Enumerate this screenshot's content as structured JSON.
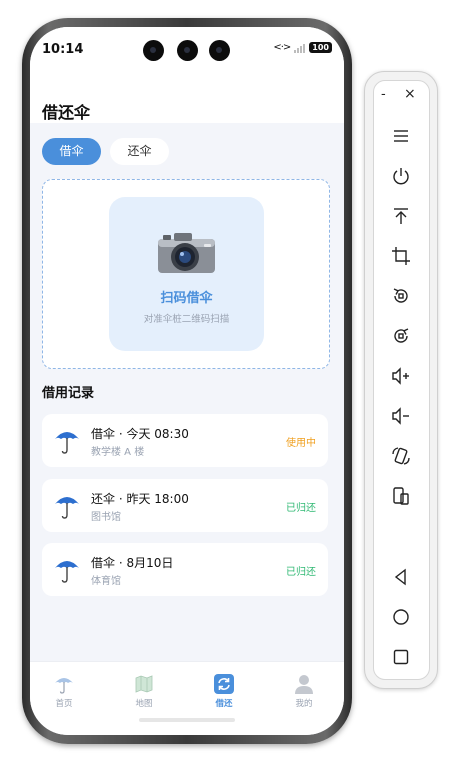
{
  "status_bar": {
    "time": "10:14",
    "network": "<·>",
    "x_mark": "x",
    "battery": "100"
  },
  "page": {
    "title": "借还伞"
  },
  "tabs": [
    {
      "label": "借伞",
      "active": true
    },
    {
      "label": "还伞",
      "active": false
    }
  ],
  "scan": {
    "title": "扫码借伞",
    "subtitle": "对准伞桩二维码扫描"
  },
  "records": {
    "heading": "借用记录",
    "items": [
      {
        "action": "借伞 · 今天 08:30",
        "location": "教学楼 A 楼",
        "status": "使用中",
        "status_color": "#f0a020"
      },
      {
        "action": "还伞 · 昨天 18:00",
        "location": "图书馆",
        "status": "已归还",
        "status_color": "#2eb872"
      },
      {
        "action": "借伞 · 8月10日",
        "location": "体育馆",
        "status": "已归还",
        "status_color": "#2eb872"
      }
    ]
  },
  "tab_bar": [
    {
      "label": "首页",
      "icon": "umbrella-icon",
      "active": false
    },
    {
      "label": "地图",
      "icon": "map-icon",
      "active": false
    },
    {
      "label": "借还",
      "icon": "refresh-icon",
      "active": true
    },
    {
      "label": "我的",
      "icon": "person-icon",
      "active": false
    }
  ],
  "emulator_toolbar": {
    "minimize": "-",
    "close": "×",
    "buttons": [
      "menu-icon",
      "power-icon",
      "upload-icon",
      "crop-icon",
      "rotate-icon",
      "rotate-alt-icon",
      "volume-up-icon",
      "volume-down-icon",
      "rotate-screen-icon",
      "fold-device-icon",
      "back-icon",
      "home-icon",
      "overview-icon"
    ]
  },
  "colors": {
    "accent": "#4a8fdb",
    "in_use": "#f0a020",
    "returned": "#2eb872"
  }
}
